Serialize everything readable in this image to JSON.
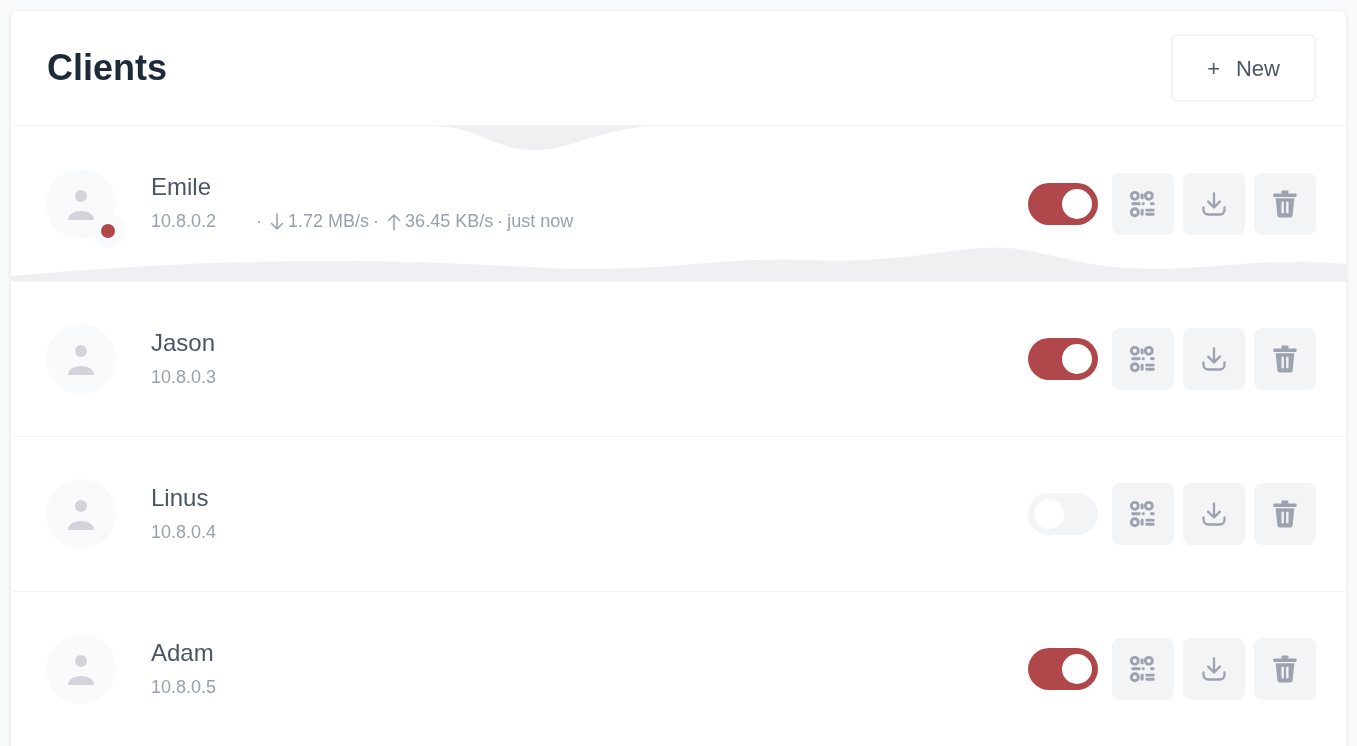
{
  "title": "Clients",
  "new_button": {
    "icon": "+",
    "label": "New"
  },
  "clients": [
    {
      "name": "Emile",
      "address": "10.8.0.2",
      "enabled": true,
      "online": true,
      "traffic": {
        "separator": "·",
        "download": "1.72 MB/s",
        "upload": "36.45 KB/s",
        "last_seen": "just now"
      }
    },
    {
      "name": "Jason",
      "address": "10.8.0.3",
      "enabled": true,
      "online": false
    },
    {
      "name": "Linus",
      "address": "10.8.0.4",
      "enabled": false,
      "online": false
    },
    {
      "name": "Adam",
      "address": "10.8.0.5",
      "enabled": true,
      "online": false
    }
  ]
}
